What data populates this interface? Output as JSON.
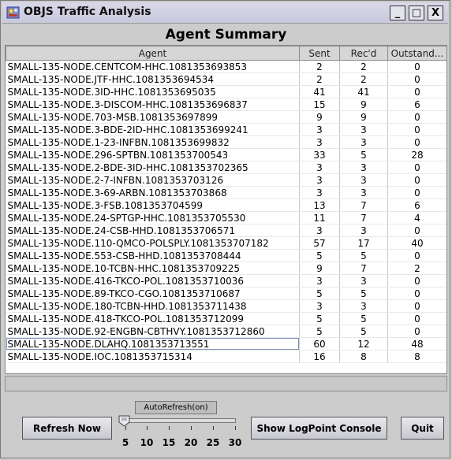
{
  "window": {
    "title": "OBJS Traffic Analysis",
    "minimize_label": "_",
    "maximize_label": "□",
    "close_label": "X"
  },
  "heading": "Agent Summary",
  "table": {
    "columns": [
      "Agent",
      "Sent",
      "Rec'd",
      "Outstand..."
    ],
    "rows": [
      [
        "SMALL-135-NODE.CENTCOM-HHC.1081353693853",
        "2",
        "2",
        "0"
      ],
      [
        "SMALL-135-NODE.JTF-HHC.1081353694534",
        "2",
        "2",
        "0"
      ],
      [
        "SMALL-135-NODE.3ID-HHC.1081353695035",
        "41",
        "41",
        "0"
      ],
      [
        "SMALL-135-NODE.3-DISCOM-HHC.1081353696837",
        "15",
        "9",
        "6"
      ],
      [
        "SMALL-135-NODE.703-MSB.1081353697899",
        "9",
        "9",
        "0"
      ],
      [
        "SMALL-135-NODE.3-BDE-2ID-HHC.1081353699241",
        "3",
        "3",
        "0"
      ],
      [
        "SMALL-135-NODE.1-23-INFBN.1081353699832",
        "3",
        "3",
        "0"
      ],
      [
        "SMALL-135-NODE.296-SPTBN.1081353700543",
        "33",
        "5",
        "28"
      ],
      [
        "SMALL-135-NODE.2-BDE-3ID-HHC.1081353702365",
        "3",
        "3",
        "0"
      ],
      [
        "SMALL-135-NODE.2-7-INFBN.1081353703126",
        "3",
        "3",
        "0"
      ],
      [
        "SMALL-135-NODE.3-69-ARBN.1081353703868",
        "3",
        "3",
        "0"
      ],
      [
        "SMALL-135-NODE.3-FSB.1081353704599",
        "13",
        "7",
        "6"
      ],
      [
        "SMALL-135-NODE.24-SPTGP-HHC.1081353705530",
        "11",
        "7",
        "4"
      ],
      [
        "SMALL-135-NODE.24-CSB-HHD.1081353706571",
        "3",
        "3",
        "0"
      ],
      [
        "SMALL-135-NODE.110-QMCO-POLSPLY.1081353707182",
        "57",
        "17",
        "40"
      ],
      [
        "SMALL-135-NODE.553-CSB-HHD.1081353708444",
        "5",
        "5",
        "0"
      ],
      [
        "SMALL-135-NODE.10-TCBN-HHC.1081353709225",
        "9",
        "7",
        "2"
      ],
      [
        "SMALL-135-NODE.416-TKCO-POL.1081353710036",
        "3",
        "3",
        "0"
      ],
      [
        "SMALL-135-NODE.89-TKCO-CGO.1081353710687",
        "5",
        "5",
        "0"
      ],
      [
        "SMALL-135-NODE.180-TCBN-HHD.1081353711438",
        "3",
        "3",
        "0"
      ],
      [
        "SMALL-135-NODE.418-TKCO-POL.1081353712099",
        "5",
        "5",
        "0"
      ],
      [
        "SMALL-135-NODE.92-ENGBN-CBTHVY.1081353712860",
        "5",
        "5",
        "0"
      ],
      [
        "SMALL-135-NODE.DLAHQ.1081353713551",
        "60",
        "12",
        "48"
      ],
      [
        "SMALL-135-NODE.IOC.1081353715314",
        "16",
        "8",
        "8"
      ]
    ],
    "selected_row": 22
  },
  "controls": {
    "refresh_label": "Refresh Now",
    "autorefresh_label": "AutoRefresh(on)",
    "slider_ticks": [
      "5",
      "10",
      "15",
      "20",
      "25",
      "30"
    ],
    "slider_value": "5",
    "logpoint_label": "Show LogPoint Console",
    "quit_label": "Quit"
  }
}
